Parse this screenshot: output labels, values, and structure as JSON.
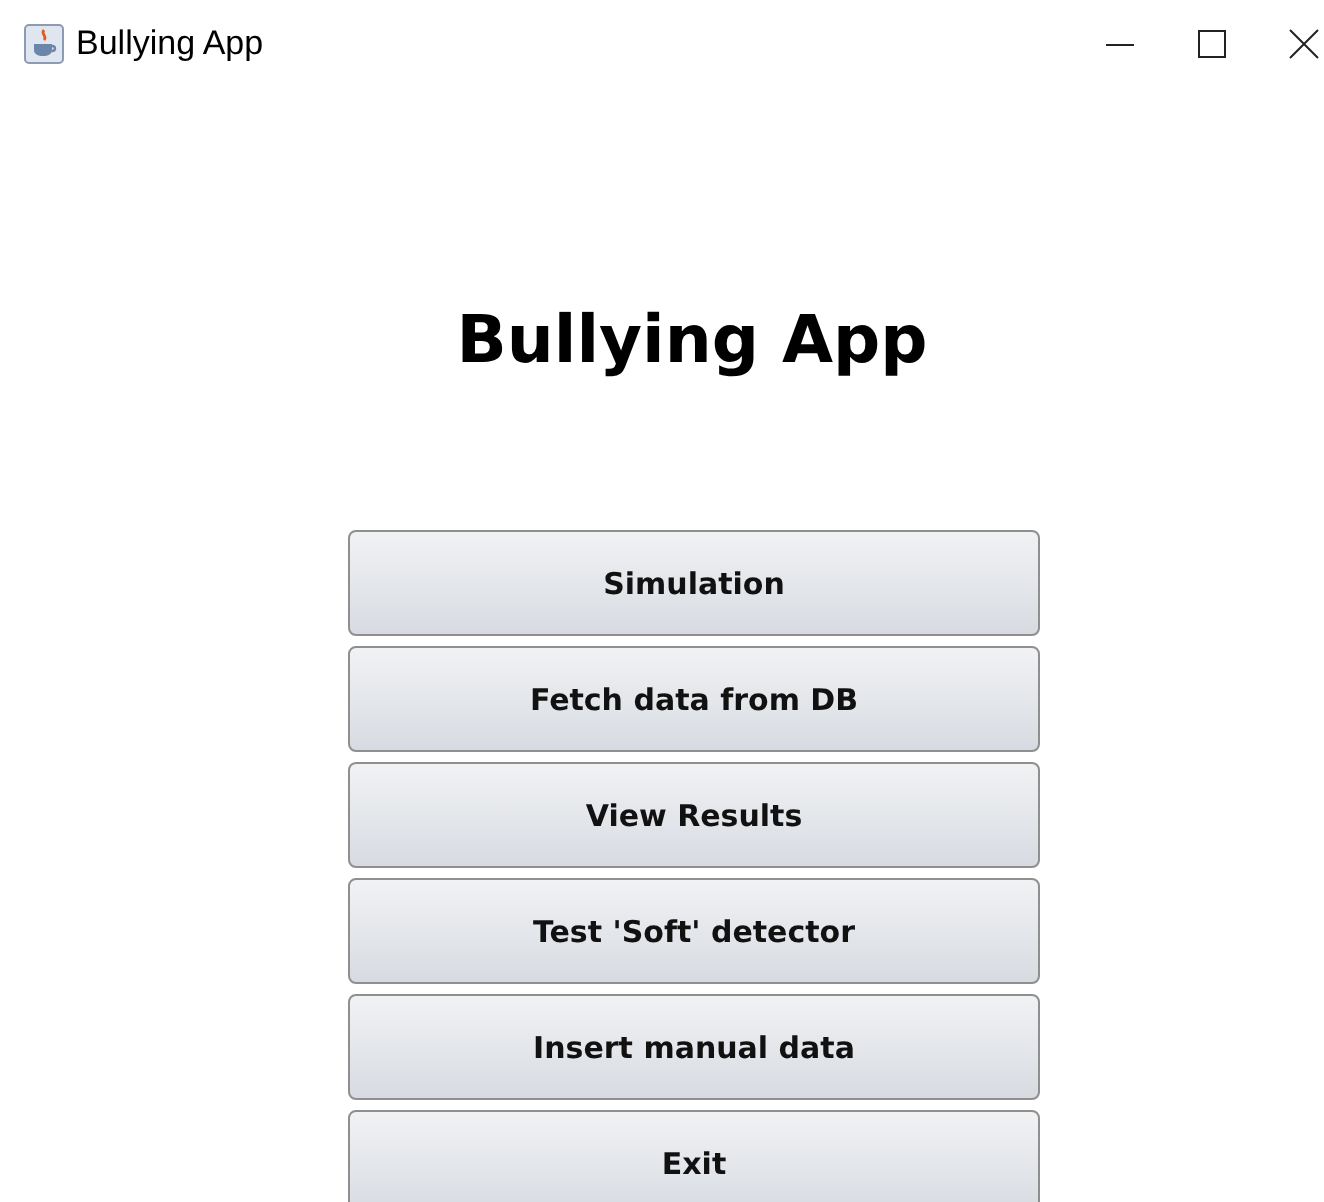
{
  "window": {
    "title": "Bullying App"
  },
  "heading": "Bullying App",
  "buttons": [
    {
      "label": "Simulation"
    },
    {
      "label": "Fetch data from DB"
    },
    {
      "label": "View Results"
    },
    {
      "label": "Test 'Soft' detector"
    },
    {
      "label": "Insert manual data"
    },
    {
      "label": "Exit"
    }
  ]
}
